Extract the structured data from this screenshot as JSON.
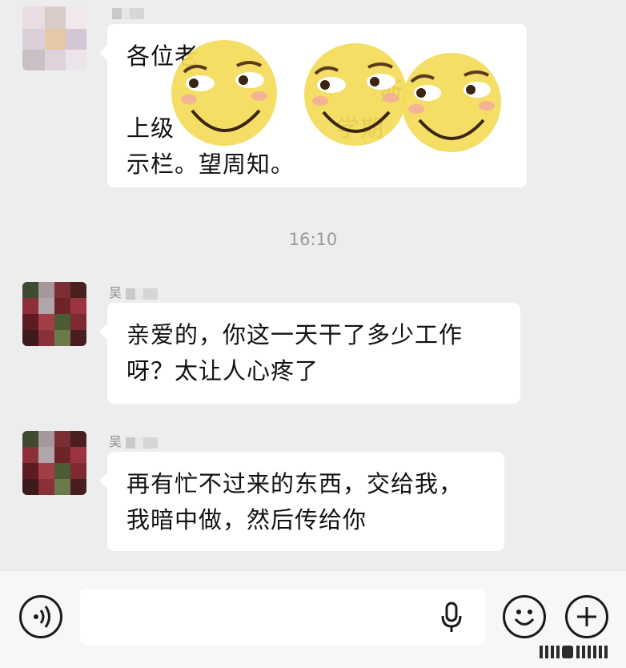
{
  "messages": [
    {
      "sender": "",
      "lines": [
        "各位老",
        "",
        "上级",
        "示栏。望周知。"
      ],
      "visible_fragments": [
        "斯",
        "学期"
      ]
    },
    {
      "sender": "吴",
      "lines": [
        "亲爱的，你这一天干了多少工作",
        "呀？太让人心疼了"
      ]
    },
    {
      "sender": "吴",
      "lines": [
        "再有忙不过来的东西，交给我，",
        "我暗中做，然后传给你"
      ]
    }
  ],
  "timestamp": "16:10",
  "input_bar": {
    "voice_icon": "voice-toggle-icon",
    "mic_icon": "microphone-icon",
    "emoji_icon": "emoji-icon",
    "more_icon": "plus-icon"
  },
  "colors": {
    "background": "#ededed",
    "bubble": "#ffffff",
    "timestamp": "#9a9a9a",
    "emoji_yellow": "#f4dc5a"
  }
}
